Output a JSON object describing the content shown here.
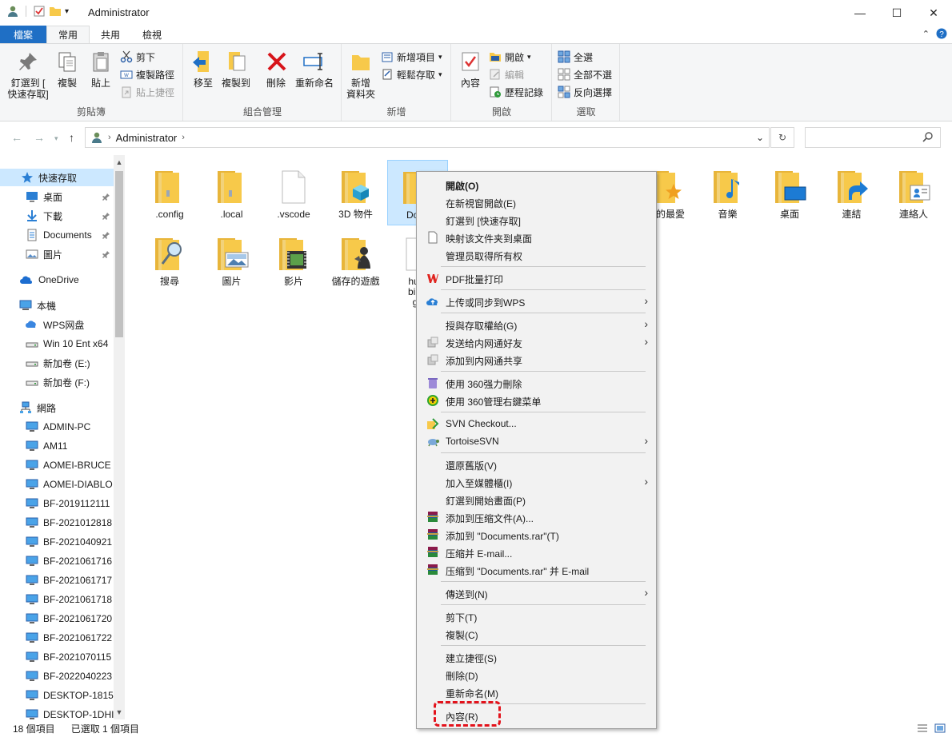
{
  "window": {
    "title": "Administrator",
    "minimize_glyph": "—",
    "maximize_glyph": "☐",
    "close_glyph": "✕"
  },
  "tabs": [
    "檔案",
    "常用",
    "共用",
    "檢視"
  ],
  "ribbon": {
    "clipboard": {
      "name": "剪貼簿",
      "pin_line1": "釘選到 [",
      "pin_line2": "快速存取]",
      "copy": "複製",
      "paste": "貼上",
      "cut": "剪下",
      "copy_path": "複製路徑",
      "paste_shortcut": "貼上捷徑"
    },
    "organize": {
      "name": "組合管理",
      "move_to": "移至",
      "copy_to": "複製到",
      "delete": "刪除",
      "rename": "重新命名"
    },
    "new": {
      "name": "新增",
      "new_folder_line1": "新增",
      "new_folder_line2": "資料夾",
      "new_item": "新增項目",
      "easy_access": "輕鬆存取"
    },
    "open": {
      "name": "開啟",
      "properties": "內容",
      "open": "開啟",
      "edit": "編輯",
      "history": "歷程記錄"
    },
    "select": {
      "name": "選取",
      "select_all": "全選",
      "select_none": "全部不選",
      "invert": "反向選擇"
    }
  },
  "address": {
    "path": "Administrator"
  },
  "nav": [
    {
      "label": "快速存取",
      "icon": "star-icon",
      "selected": true
    },
    {
      "label": "桌面",
      "icon": "desktop-icon",
      "pinned": true
    },
    {
      "label": "下載",
      "icon": "download-icon",
      "pinned": true
    },
    {
      "label": "Documents",
      "icon": "document-icon",
      "pinned": true
    },
    {
      "label": "圖片",
      "icon": "picture-icon",
      "pinned": true
    },
    {
      "label": "OneDrive",
      "icon": "cloud-icon"
    },
    {
      "label": "本機",
      "icon": "computer-icon"
    },
    {
      "label": "WPS网盘",
      "icon": "cloud-drive-icon"
    },
    {
      "label": "Win 10 Ent x64",
      "icon": "drive-icon"
    },
    {
      "label": "新加卷 (E:)",
      "icon": "drive-icon"
    },
    {
      "label": "新加卷 (F:)",
      "icon": "drive-icon"
    },
    {
      "label": "網路",
      "icon": "network-icon"
    },
    {
      "label": "ADMIN-PC",
      "icon": "pc-icon"
    },
    {
      "label": "AM11",
      "icon": "pc-icon"
    },
    {
      "label": "AOMEI-BRUCE",
      "icon": "pc-icon"
    },
    {
      "label": "AOMEI-DIABLO",
      "icon": "pc-icon"
    },
    {
      "label": "BF-2019112111",
      "icon": "pc-icon"
    },
    {
      "label": "BF-2021012818",
      "icon": "pc-icon"
    },
    {
      "label": "BF-2021040921",
      "icon": "pc-icon"
    },
    {
      "label": "BF-2021061716",
      "icon": "pc-icon"
    },
    {
      "label": "BF-2021061717",
      "icon": "pc-icon"
    },
    {
      "label": "BF-2021061718",
      "icon": "pc-icon"
    },
    {
      "label": "BF-2021061720",
      "icon": "pc-icon"
    },
    {
      "label": "BF-2021061722",
      "icon": "pc-icon"
    },
    {
      "label": "BF-2021070115",
      "icon": "pc-icon"
    },
    {
      "label": "BF-2022040223",
      "icon": "pc-icon"
    },
    {
      "label": "DESKTOP-1815",
      "icon": "pc-icon"
    },
    {
      "label": "DESKTOP-1DHI",
      "icon": "pc-icon"
    }
  ],
  "files": [
    {
      "label": ".config",
      "icon": "folder-icon"
    },
    {
      "label": ".local",
      "icon": "folder-icon"
    },
    {
      "label": ".vscode",
      "icon": "file-icon"
    },
    {
      "label": "3D 物件",
      "icon": "folder-3d-icon"
    },
    {
      "label": "Docu",
      "icon": "folder-documents-icon",
      "selected": true
    },
    {
      "label": "",
      "icon": "folder-icon"
    },
    {
      "label": "",
      "icon": "folder-icon"
    },
    {
      "label": "",
      "icon": "folder-icon"
    },
    {
      "label": "我的最愛",
      "icon": "folder-favorites-icon"
    },
    {
      "label": "音樂",
      "icon": "folder-music-icon"
    },
    {
      "label": "桌面",
      "icon": "folder-desktop-icon"
    },
    {
      "label": "連結",
      "icon": "folder-links-icon"
    },
    {
      "label": "連絡人",
      "icon": "folder-contacts-icon"
    },
    {
      "label": "搜尋",
      "icon": "folder-search-icon"
    },
    {
      "label": "圖片",
      "icon": "folder-pictures-icon"
    },
    {
      "label": "影片",
      "icon": "folder-videos-icon"
    },
    {
      "label": "儲存的遊戲",
      "icon": "folder-games-icon"
    },
    {
      "label": "hum",
      "label2": "bird-",
      "label3": "g.j",
      "icon": "image-file-icon"
    }
  ],
  "context_menu": [
    {
      "label": "開啟(O)",
      "bold": true
    },
    {
      "label": "在新視窗開啟(E)"
    },
    {
      "label": "釘選到 [快速存取]"
    },
    {
      "label": "映射该文件夹到桌面",
      "icon": "page-icon"
    },
    {
      "label": "管理员取得所有权"
    },
    {
      "sep": true
    },
    {
      "label": "PDF批量打印",
      "icon": "wps-icon"
    },
    {
      "sep": true
    },
    {
      "label": "上传或同步到WPS",
      "icon": "upload-cloud-icon",
      "arrow": true
    },
    {
      "sep": true
    },
    {
      "label": "授與存取權給(G)",
      "arrow": true
    },
    {
      "label": "发送给内网通好友",
      "icon": "share-icon",
      "arrow": true
    },
    {
      "label": "添加到内网通共享",
      "icon": "share-icon"
    },
    {
      "sep": true
    },
    {
      "label": "使用 360强力刪除",
      "icon": "trash-360-icon"
    },
    {
      "label": "使用 360管理右鍵菜单",
      "icon": "plus-360-icon"
    },
    {
      "sep": true
    },
    {
      "label": "SVN Checkout...",
      "icon": "svn-checkout-icon"
    },
    {
      "label": "TortoiseSVN",
      "icon": "tortoise-icon",
      "arrow": true
    },
    {
      "sep": true
    },
    {
      "label": "還原舊版(V)"
    },
    {
      "label": "加入至媒體櫃(I)",
      "arrow": true
    },
    {
      "label": "釘選到開始畫面(P)"
    },
    {
      "label": "添加到压缩文件(A)...",
      "icon": "winrar-icon"
    },
    {
      "label": "添加到 \"Documents.rar\"(T)",
      "icon": "winrar-icon"
    },
    {
      "label": "压缩并 E-mail...",
      "icon": "winrar-icon"
    },
    {
      "label": "压缩到 \"Documents.rar\" 并 E-mail",
      "icon": "winrar-icon"
    },
    {
      "sep": true
    },
    {
      "label": "傳送到(N)",
      "arrow": true
    },
    {
      "sep": true
    },
    {
      "label": "剪下(T)"
    },
    {
      "label": "複製(C)"
    },
    {
      "sep": true
    },
    {
      "label": "建立捷徑(S)"
    },
    {
      "label": "刪除(D)"
    },
    {
      "label": "重新命名(M)"
    },
    {
      "sep": true
    },
    {
      "label": "內容(R)"
    }
  ],
  "status": {
    "count": "18 個項目",
    "selected": "已選取 1 個項目"
  },
  "colors": {
    "accent": "#1f6fc5",
    "folder": "#f7c94a",
    "selection": "#cce8ff",
    "highlight": "#e3121b"
  }
}
